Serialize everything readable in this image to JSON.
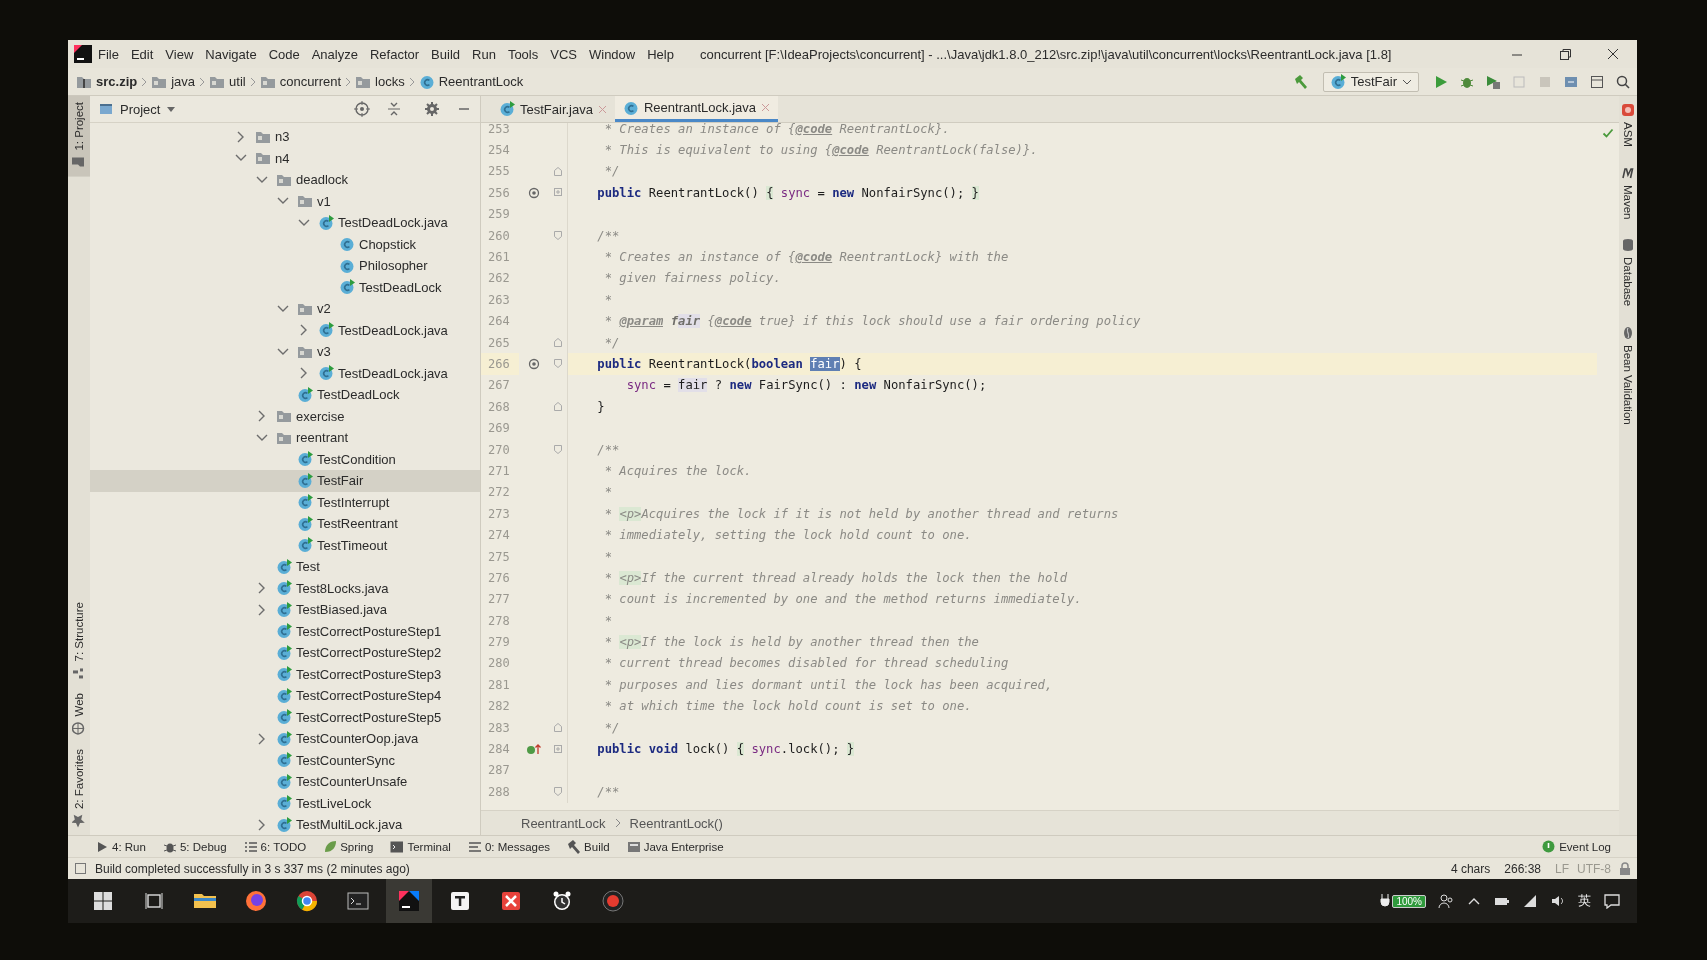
{
  "window": {
    "title": "concurrent [F:\\IdeaProjects\\concurrent] - ...\\Java\\jdk1.8.0_212\\src.zip!\\java\\util\\concurrent\\locks\\ReentrantLock.java [1.8]"
  },
  "menu": [
    "File",
    "Edit",
    "View",
    "Navigate",
    "Code",
    "Analyze",
    "Refactor",
    "Build",
    "Run",
    "Tools",
    "VCS",
    "Window",
    "Help"
  ],
  "nav_path": [
    {
      "label": "src.zip",
      "kind": "archive"
    },
    {
      "label": "java",
      "kind": "package"
    },
    {
      "label": "util",
      "kind": "package"
    },
    {
      "label": "concurrent",
      "kind": "package"
    },
    {
      "label": "locks",
      "kind": "package"
    },
    {
      "label": "ReentrantLock",
      "kind": "class"
    }
  ],
  "run_config": {
    "label": "TestFair"
  },
  "left_tool_windows": {
    "top": [
      {
        "label": "1: Project",
        "kind": "project",
        "selected": true
      }
    ],
    "bottom": [
      {
        "label": "7: Structure",
        "kind": "structure",
        "selected": false
      },
      {
        "label": "Web",
        "kind": "web",
        "selected": false
      },
      {
        "label": "2: Favorites",
        "kind": "favorites",
        "selected": false
      }
    ]
  },
  "right_tool_windows": [
    {
      "label": "ASM",
      "kind": "asm"
    },
    {
      "label": "Maven",
      "kind": "maven"
    },
    {
      "label": "Database",
      "kind": "database"
    },
    {
      "label": "Bean Validation",
      "kind": "bean"
    }
  ],
  "project_panel": {
    "title": "Project",
    "tree": [
      {
        "label": "n3",
        "kind": "folder",
        "expanded": false,
        "selected": false
      },
      {
        "label": "n4",
        "kind": "folder",
        "expanded": true,
        "selected": false,
        "children": [
          {
            "label": "deadlock",
            "kind": "folder",
            "expanded": true,
            "selected": false,
            "children": [
              {
                "label": "v1",
                "kind": "folder",
                "expanded": true,
                "selected": false,
                "children": [
                  {
                    "label": "TestDeadLock.java",
                    "kind": "runnable",
                    "expanded": true,
                    "selected": false,
                    "children": [
                      {
                        "label": "Chopstick",
                        "kind": "class",
                        "selected": false
                      },
                      {
                        "label": "Philosopher",
                        "kind": "class",
                        "selected": false
                      },
                      {
                        "label": "TestDeadLock",
                        "kind": "runnable",
                        "selected": false
                      }
                    ]
                  }
                ]
              },
              {
                "label": "v2",
                "kind": "folder",
                "expanded": true,
                "selected": false,
                "children": [
                  {
                    "label": "TestDeadLock.java",
                    "kind": "runnable",
                    "expanded": false,
                    "selected": false
                  }
                ]
              },
              {
                "label": "v3",
                "kind": "folder",
                "expanded": true,
                "selected": false,
                "children": [
                  {
                    "label": "TestDeadLock.java",
                    "kind": "runnable",
                    "expanded": false,
                    "selected": false
                  }
                ]
              },
              {
                "label": "TestDeadLock",
                "kind": "runnable",
                "selected": false
              }
            ]
          },
          {
            "label": "exercise",
            "kind": "folder",
            "expanded": false,
            "selected": false
          },
          {
            "label": "reentrant",
            "kind": "folder",
            "expanded": true,
            "selected": false,
            "children": [
              {
                "label": "TestCondition",
                "kind": "runnable",
                "selected": false
              },
              {
                "label": "TestFair",
                "kind": "runnable",
                "selected": true
              },
              {
                "label": "TestInterrupt",
                "kind": "runnable",
                "selected": false
              },
              {
                "label": "TestReentrant",
                "kind": "runnable",
                "selected": false
              },
              {
                "label": "TestTimeout",
                "kind": "runnable",
                "selected": false
              }
            ]
          },
          {
            "label": "Test",
            "kind": "runnable",
            "selected": false
          },
          {
            "label": "Test8Locks.java",
            "kind": "runnable",
            "expanded": false,
            "selected": false
          },
          {
            "label": "TestBiased.java",
            "kind": "runnable",
            "expanded": false,
            "selected": false
          },
          {
            "label": "TestCorrectPostureStep1",
            "kind": "runnable",
            "selected": false
          },
          {
            "label": "TestCorrectPostureStep2",
            "kind": "runnable",
            "selected": false
          },
          {
            "label": "TestCorrectPostureStep3",
            "kind": "runnable",
            "selected": false
          },
          {
            "label": "TestCorrectPostureStep4",
            "kind": "runnable",
            "selected": false
          },
          {
            "label": "TestCorrectPostureStep5",
            "kind": "runnable",
            "selected": false
          },
          {
            "label": "TestCounterOop.java",
            "kind": "runnable",
            "expanded": false,
            "selected": false
          },
          {
            "label": "TestCounterSync",
            "kind": "runnable",
            "selected": false
          },
          {
            "label": "TestCounterUnsafe",
            "kind": "runnable",
            "selected": false
          },
          {
            "label": "TestLiveLock",
            "kind": "runnable",
            "selected": false
          },
          {
            "label": "TestMultiLock.java",
            "kind": "runnable",
            "expanded": false,
            "selected": false
          }
        ]
      }
    ]
  },
  "editor_tabs": [
    {
      "label": "TestFair.java",
      "selected": false
    },
    {
      "label": "ReentrantLock.java",
      "selected": true
    }
  ],
  "editor": {
    "lines": [
      {
        "number": "253",
        "current": false,
        "tokens": [
          {
            "kind": "c",
            "text": "     * Creates an instance of {"
          },
          {
            "kind": "ct",
            "text": "@code"
          },
          {
            "kind": "c",
            "text": " ReentrantLock}."
          }
        ]
      },
      {
        "number": "254",
        "current": false,
        "tokens": [
          {
            "kind": "c",
            "text": "     * This is equivalent to using {"
          },
          {
            "kind": "ct",
            "text": "@code"
          },
          {
            "kind": "c",
            "text": " ReentrantLock(false)}."
          }
        ]
      },
      {
        "number": "255",
        "current": false,
        "fold_marker": {
          "kind": "end"
        },
        "tokens": [
          {
            "kind": "c",
            "text": "     */"
          }
        ]
      },
      {
        "number": "256",
        "current": false,
        "gutter_icon": {
          "kind": "override"
        },
        "fold_marker": {
          "kind": "folded"
        },
        "tokens": [
          {
            "kind": "k",
            "text": "    public"
          },
          {
            "kind": "p",
            "text": " ReentrantLock() "
          },
          {
            "kind": "b",
            "text": "{"
          },
          {
            "kind": "f",
            "text": " sync"
          },
          {
            "kind": "p",
            "text": " = "
          },
          {
            "kind": "k",
            "text": "new"
          },
          {
            "kind": "p",
            "text": " NonfairSync(); "
          },
          {
            "kind": "b",
            "text": "}"
          }
        ]
      },
      {
        "number": "259",
        "current": false
      },
      {
        "number": "260",
        "current": false,
        "fold_marker": {
          "kind": "start"
        },
        "tokens": [
          {
            "kind": "c",
            "text": "    /**"
          }
        ]
      },
      {
        "number": "261",
        "current": false,
        "tokens": [
          {
            "kind": "c",
            "text": "     * Creates an instance of {"
          },
          {
            "kind": "ct",
            "text": "@code"
          },
          {
            "kind": "c",
            "text": " ReentrantLock} with the"
          }
        ]
      },
      {
        "number": "262",
        "current": false,
        "tokens": [
          {
            "kind": "c",
            "text": "     * given fairness policy."
          }
        ]
      },
      {
        "number": "263",
        "current": false,
        "tokens": [
          {
            "kind": "c",
            "text": "     *"
          }
        ]
      },
      {
        "number": "264",
        "current": false,
        "tokens": [
          {
            "kind": "c",
            "text": "     * "
          },
          {
            "kind": "ct",
            "text": "@param"
          },
          {
            "kind": "cp",
            "text": " fair"
          },
          {
            "kind": "c",
            "text": " {"
          },
          {
            "kind": "ct",
            "text": "@code"
          },
          {
            "kind": "c",
            "text": " true} if this lock should use a fair ordering policy"
          }
        ]
      },
      {
        "number": "265",
        "current": false,
        "fold_marker": {
          "kind": "end"
        },
        "tokens": [
          {
            "kind": "c",
            "text": "     */"
          }
        ]
      },
      {
        "number": "266",
        "current": true,
        "gutter_icon": {
          "kind": "override"
        },
        "fold_marker": {
          "kind": "start"
        },
        "tokens": [
          {
            "kind": "k",
            "text": "    public"
          },
          {
            "kind": "p",
            "text": " ReentrantLock("
          },
          {
            "kind": "k",
            "text": "boolean "
          },
          {
            "kind": "s",
            "text": "fair"
          },
          {
            "kind": "p",
            "text": ") {"
          }
        ]
      },
      {
        "number": "267",
        "current": false,
        "tokens": [
          {
            "kind": "f",
            "text": "        sync"
          },
          {
            "kind": "p",
            "text": " = "
          },
          {
            "kind": "v",
            "text": "fair"
          },
          {
            "kind": "p",
            "text": " ? "
          },
          {
            "kind": "k",
            "text": "new"
          },
          {
            "kind": "p",
            "text": " FairSync() : "
          },
          {
            "kind": "k",
            "text": "new"
          },
          {
            "kind": "p",
            "text": " NonfairSync();"
          }
        ]
      },
      {
        "number": "268",
        "current": false,
        "fold_marker": {
          "kind": "end"
        },
        "tokens": [
          {
            "kind": "p",
            "text": "    }"
          }
        ]
      },
      {
        "number": "269",
        "current": false
      },
      {
        "number": "270",
        "current": false,
        "fold_marker": {
          "kind": "start"
        },
        "tokens": [
          {
            "kind": "c",
            "text": "    /**"
          }
        ]
      },
      {
        "number": "271",
        "current": false,
        "tokens": [
          {
            "kind": "c",
            "text": "     * Acquires the lock."
          }
        ]
      },
      {
        "number": "272",
        "current": false,
        "tokens": [
          {
            "kind": "c",
            "text": "     *"
          }
        ]
      },
      {
        "number": "273",
        "current": false,
        "tokens": [
          {
            "kind": "c",
            "text": "     * "
          },
          {
            "kind": "cg",
            "text": "<p>"
          },
          {
            "kind": "c",
            "text": "Acquires the lock if it is not held by another thread and returns"
          }
        ]
      },
      {
        "number": "274",
        "current": false,
        "tokens": [
          {
            "kind": "c",
            "text": "     * immediately, setting the lock hold count to one."
          }
        ]
      },
      {
        "number": "275",
        "current": false,
        "tokens": [
          {
            "kind": "c",
            "text": "     *"
          }
        ]
      },
      {
        "number": "276",
        "current": false,
        "tokens": [
          {
            "kind": "c",
            "text": "     * "
          },
          {
            "kind": "cg",
            "text": "<p>"
          },
          {
            "kind": "c",
            "text": "If the current thread already holds the lock then the hold"
          }
        ]
      },
      {
        "number": "277",
        "current": false,
        "tokens": [
          {
            "kind": "c",
            "text": "     * count is incremented by one and the method returns immediately."
          }
        ]
      },
      {
        "number": "278",
        "current": false,
        "tokens": [
          {
            "kind": "c",
            "text": "     *"
          }
        ]
      },
      {
        "number": "279",
        "current": false,
        "tokens": [
          {
            "kind": "c",
            "text": "     * "
          },
          {
            "kind": "cg",
            "text": "<p>"
          },
          {
            "kind": "c",
            "text": "If the lock is held by another thread then the"
          }
        ]
      },
      {
        "number": "280",
        "current": false,
        "tokens": [
          {
            "kind": "c",
            "text": "     * current thread becomes disabled for thread scheduling"
          }
        ]
      },
      {
        "number": "281",
        "current": false,
        "tokens": [
          {
            "kind": "c",
            "text": "     * purposes and lies dormant until the lock has been acquired,"
          }
        ]
      },
      {
        "number": "282",
        "current": false,
        "tokens": [
          {
            "kind": "c",
            "text": "     * at which time the lock hold count is set to one."
          }
        ]
      },
      {
        "number": "283",
        "current": false,
        "fold_marker": {
          "kind": "end"
        },
        "tokens": [
          {
            "kind": "c",
            "text": "     */"
          }
        ]
      },
      {
        "number": "284",
        "current": false,
        "gutter_icon": {
          "kind": "implements"
        },
        "fold_marker": {
          "kind": "folded"
        },
        "tokens": [
          {
            "kind": "k",
            "text": "    public void"
          },
          {
            "kind": "p",
            "text": " lock() "
          },
          {
            "kind": "b",
            "text": "{"
          },
          {
            "kind": "f",
            "text": " sync"
          },
          {
            "kind": "p",
            "text": ".lock(); "
          },
          {
            "kind": "b",
            "text": "}"
          }
        ]
      },
      {
        "number": "287",
        "current": false
      },
      {
        "number": "288",
        "current": false,
        "fold_marker": {
          "kind": "start"
        },
        "tokens": [
          {
            "kind": "c",
            "text": "    /**"
          }
        ]
      }
    ],
    "breadcrumbs": [
      "ReentrantLock",
      "ReentrantLock()"
    ]
  },
  "bottom_tool_windows": [
    {
      "label": "4: Run",
      "kind": "run"
    },
    {
      "label": "5: Debug",
      "kind": "debug"
    },
    {
      "label": "6: TODO",
      "kind": "todo"
    },
    {
      "label": "Spring",
      "kind": "spring"
    },
    {
      "label": "Terminal",
      "kind": "terminal"
    },
    {
      "label": "0: Messages",
      "kind": "messages"
    },
    {
      "label": "Build",
      "kind": "build"
    },
    {
      "label": "Java Enterprise",
      "kind": "enterprise"
    }
  ],
  "event_log": "Event Log",
  "status_bar": {
    "message": "Build completed successfully in 3 s 337 ms (2 minutes ago)",
    "selection": "4 chars",
    "position": "266:38",
    "line_separator": "LF",
    "encoding": "UTF-8"
  },
  "taskbar": {
    "apps": [
      {
        "kind": "explorer",
        "selected": false
      },
      {
        "kind": "firefox",
        "selected": false
      },
      {
        "kind": "chrome",
        "selected": false
      },
      {
        "kind": "terminal",
        "selected": false
      },
      {
        "kind": "intellij",
        "selected": true
      },
      {
        "kind": "typora",
        "selected": false
      },
      {
        "kind": "xmind",
        "selected": false
      },
      {
        "kind": "clock",
        "selected": false
      },
      {
        "kind": "recorder",
        "selected": false
      }
    ],
    "battery": "100%",
    "input_method": "英"
  }
}
